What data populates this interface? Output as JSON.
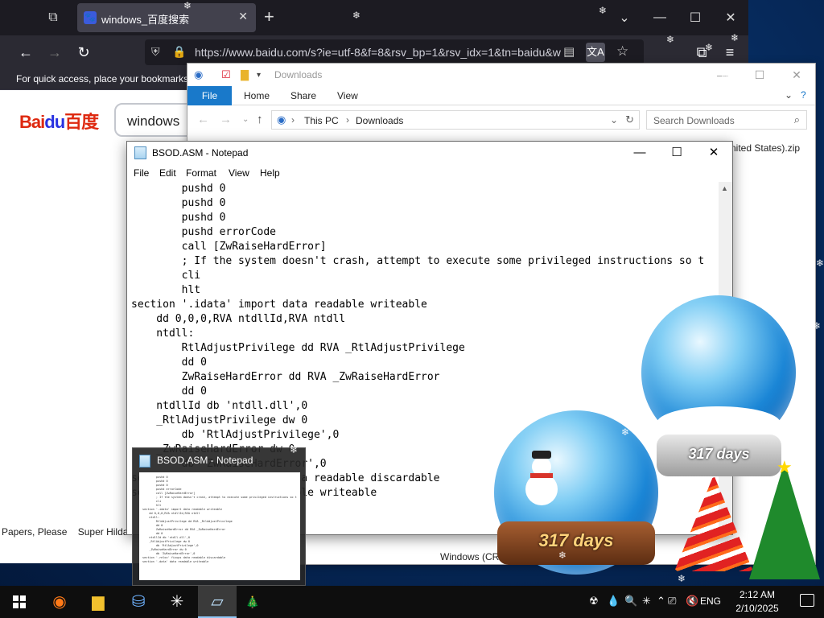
{
  "browser": {
    "tab_title": "windows_百度搜索",
    "url": "https://www.baidu.com/s?ie=utf-8&f=8&rsv_bp=1&rsv_idx=1&tn=baidu&w",
    "bookmark_hint": "For quick access, place your bookmarks",
    "page": {
      "logo_bai": "Bai",
      "logo_du": "du",
      "logo_cn": "百度",
      "search_value": "windows",
      "footer_links": [
        "Papers, Please",
        "Super Hilda"
      ]
    }
  },
  "explorer": {
    "title": "Downloads",
    "ribbon_tabs": [
      "File",
      "Home",
      "Share",
      "View"
    ],
    "breadcrumb": [
      "This PC",
      "Downloads"
    ],
    "search_placeholder": "Search Downloads",
    "file_partial": "nited States).zip",
    "status_partial": "Windows (CRE"
  },
  "notepad": {
    "title": "BSOD.ASM - Notepad",
    "menu": [
      "File",
      "Edit",
      "Format",
      "View",
      "Help"
    ],
    "text": "        pushd 0\n        pushd 0\n        pushd 0\n        pushd errorCode\n        call [ZwRaiseHardError]\n        ; If the system doesn't crash, attempt to execute some privileged instructions so t\n        cli\n        hlt\nsection '.idata' import data readable writeable\n    dd 0,0,0,RVA ntdllId,RVA ntdll\n    ntdll:\n        RtlAdjustPrivilege dd RVA _RtlAdjustPrivilege\n        dd 0\n        ZwRaiseHardError dd RVA _ZwRaiseHardError\n        dd 0\n    ntdllId db 'ntdll.dll',0\n    _RtlAdjustPrivilege dw 0\n        db 'RtlAdjustPrivilege',0\n    _ZwRaiseHardError dw 0\n        db 'ZwRaiseHardError',0\nsection '.reloc' fixups data readable discardable\nsection '.data' data readable writeable"
  },
  "thumbnail": {
    "title": "BSOD.ASM - Notepad"
  },
  "decorations": {
    "globe_days": "317 days"
  },
  "taskbar": {
    "apps": [
      "start",
      "firefox",
      "file-explorer",
      "app-store",
      "snowflake-app",
      "notepad"
    ],
    "language": "ENG",
    "time": "2:12 AM",
    "date": "2/10/2025"
  }
}
